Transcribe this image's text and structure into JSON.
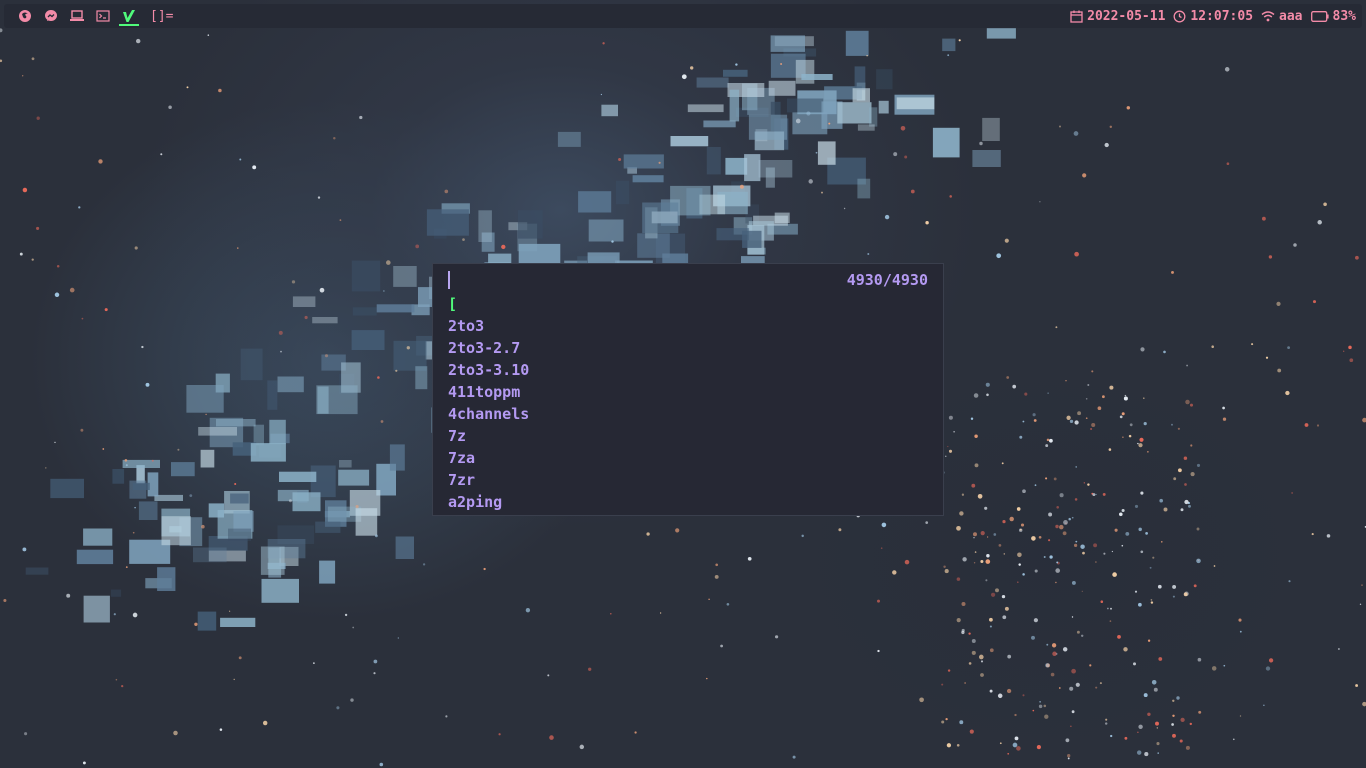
{
  "topbar": {
    "tags": [
      {
        "icon": "firefox-icon",
        "color": "#f38ba8",
        "active": false
      },
      {
        "icon": "messenger-icon",
        "color": "#f38ba8",
        "active": false
      },
      {
        "icon": "laptop-icon",
        "color": "#f38ba8",
        "active": false
      },
      {
        "icon": "terminal-icon",
        "color": "#f38ba8",
        "active": false
      },
      {
        "icon": "vim-icon",
        "color": "#50fa7b",
        "active": true
      }
    ],
    "layout_symbol": "[]=",
    "date": "2022-05-11",
    "time": "12:07:05",
    "wifi": "aaa",
    "battery": "83%"
  },
  "launcher": {
    "input_value": "",
    "counter": "4930/4930",
    "items": [
      "[",
      "2to3",
      "2to3-2.7",
      "2to3-3.10",
      "411toppm",
      "4channels",
      "7z",
      "7za",
      "7zr",
      "a2ping"
    ],
    "selected_index": 0
  },
  "colors": {
    "accent": "#f38ba8",
    "item_text": "#b49af2",
    "selected": "#50fa7b",
    "bar_bg": "#262a35",
    "launcher_bg": "#262834"
  }
}
